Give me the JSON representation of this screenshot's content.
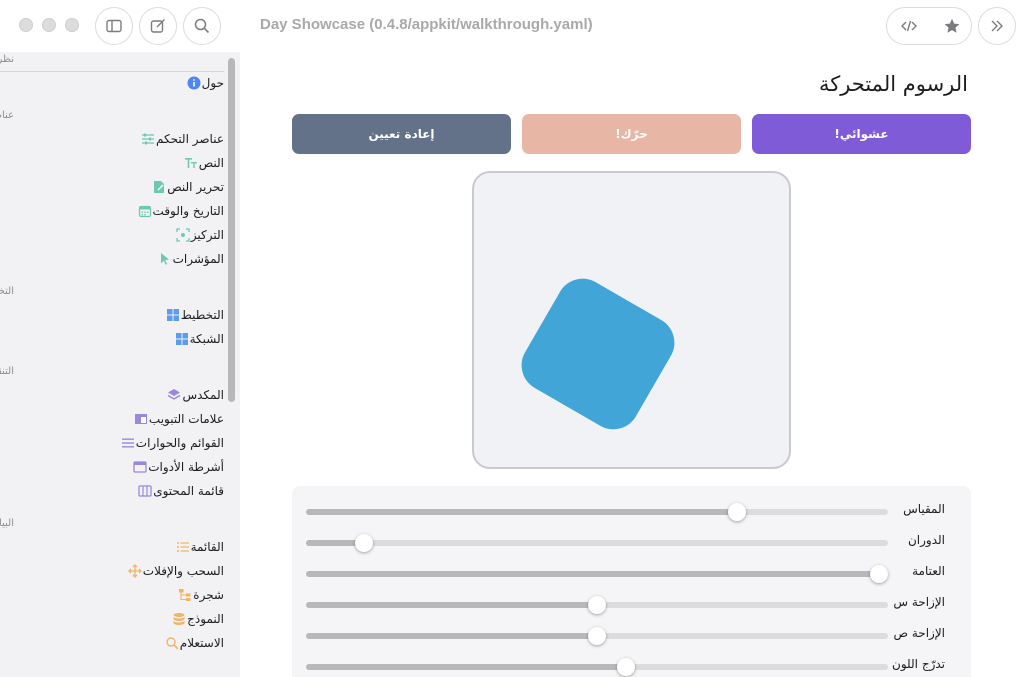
{
  "window": {
    "title": "Day Showcase (0.4.8/appkit/walkthrough.yaml)"
  },
  "sidebar": {
    "sections": [
      {
        "title": "نظرة عامة",
        "items": [
          {
            "label": "حول",
            "icon": "info-icon",
            "color": "#4f86f7"
          }
        ]
      },
      {
        "title": "عناصر التحكم",
        "items": [
          {
            "label": "عناصر التحكم",
            "icon": "sliders-icon",
            "color": "#6ec9b2"
          },
          {
            "label": "النص",
            "icon": "text-icon",
            "color": "#6ec9b2"
          },
          {
            "label": "تحرير النص",
            "icon": "edit-document-icon",
            "color": "#6ec9b2"
          },
          {
            "label": "التاريخ والوقت",
            "icon": "calendar-icon",
            "color": "#6ec9b2"
          },
          {
            "label": "التركيز",
            "icon": "focus-icon",
            "color": "#6ec9b2"
          },
          {
            "label": "المؤشرات",
            "icon": "cursor-icon",
            "color": "#6ec9b2"
          }
        ]
      },
      {
        "title": "التخطيط",
        "items": [
          {
            "label": "التخطيط",
            "icon": "layout-icon",
            "color": "#5b9bf0"
          },
          {
            "label": "الشبكة",
            "icon": "grid-icon",
            "color": "#5b9bf0"
          }
        ]
      },
      {
        "title": "التنقل والواجهة",
        "items": [
          {
            "label": "المكدس",
            "icon": "stack-icon",
            "color": "#9b87e0"
          },
          {
            "label": "علامات التبويب",
            "icon": "tabs-icon",
            "color": "#9b87e0"
          },
          {
            "label": "القوائم والحوارات",
            "icon": "menu-icon",
            "color": "#9b87e0"
          },
          {
            "label": "أشرطة الأدوات",
            "icon": "toolbar-icon",
            "color": "#9b87e0"
          },
          {
            "label": "قائمة المحتوى",
            "icon": "columns-icon",
            "color": "#9b87e0"
          }
        ]
      },
      {
        "title": "البيانات",
        "items": [
          {
            "label": "القائمة",
            "icon": "list-icon",
            "color": "#f0b36a"
          },
          {
            "label": "السحب والإفلات",
            "icon": "move-icon",
            "color": "#f0b36a"
          },
          {
            "label": "شجرة",
            "icon": "tree-icon",
            "color": "#f0b36a"
          },
          {
            "label": "النموذج",
            "icon": "database-icon",
            "color": "#f0b36a"
          },
          {
            "label": "الاستعلام",
            "icon": "search-icon",
            "color": "#f0b36a"
          }
        ]
      }
    ]
  },
  "main": {
    "title": "الرسوم المتحركة",
    "buttons": {
      "random": {
        "label": "عشوائي!",
        "color": "#7f5bd8"
      },
      "move": {
        "label": "حرّك!",
        "color": "#e8b6a4"
      },
      "reset": {
        "label": "إعادة تعيين",
        "color": "#637189"
      }
    },
    "shape_color": "#42a5d8",
    "sliders": [
      {
        "label": "المقياس",
        "value": 0.74
      },
      {
        "label": "الدوران",
        "value": 0.1
      },
      {
        "label": "العتامة",
        "value": 1.0
      },
      {
        "label": "الإزاحة س",
        "value": 0.5
      },
      {
        "label": "الإزاحة ص",
        "value": 0.5
      },
      {
        "label": "تدرّج اللون",
        "value": 0.55
      }
    ]
  }
}
